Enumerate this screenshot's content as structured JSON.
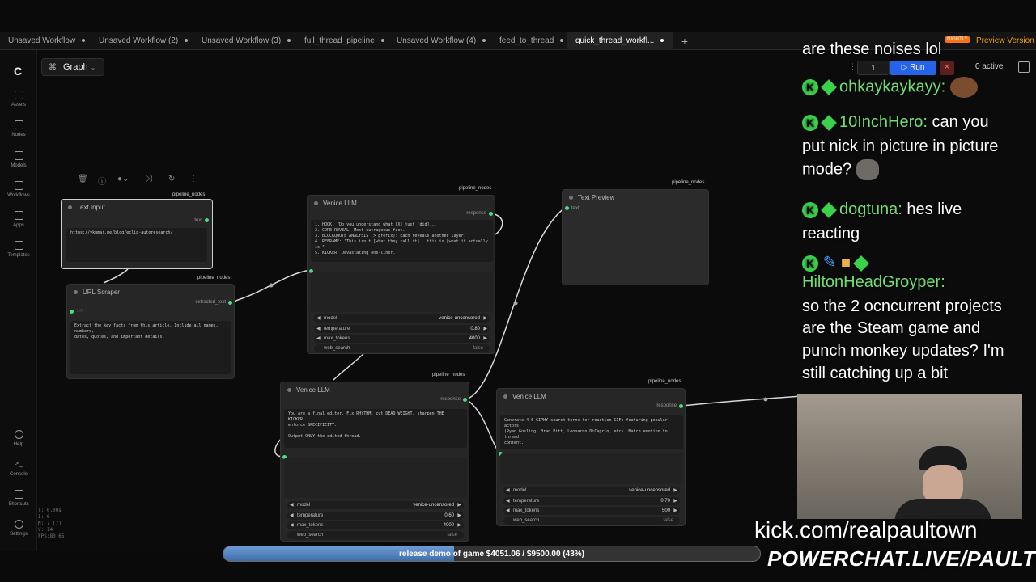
{
  "tabs": [
    {
      "label": "Unsaved Workflow"
    },
    {
      "label": "Unsaved Workflow (2)"
    },
    {
      "label": "Unsaved Workflow (3)"
    },
    {
      "label": "full_thread_pipeline"
    },
    {
      "label": "Unsaved Workflow (4)"
    },
    {
      "label": "feed_to_thread"
    },
    {
      "label": "quick_thread_workfl..."
    }
  ],
  "sidebar": {
    "items": [
      {
        "label": "Assets"
      },
      {
        "label": "Nodes"
      },
      {
        "label": "Models"
      },
      {
        "label": "Workflows"
      },
      {
        "label": "Apps"
      },
      {
        "label": "Templates"
      },
      {
        "label": "Help"
      },
      {
        "label": "Console"
      },
      {
        "label": "Shortcuts"
      },
      {
        "label": "Settings"
      }
    ]
  },
  "graph_button": "Graph",
  "run": {
    "count": "1",
    "run_label": "Run",
    "active_label": "0 active",
    "nightly": "NIGHTLY",
    "preview": "Preview Version"
  },
  "nodes": {
    "text_input": {
      "title": "Text Input",
      "tag": "pipeline_nodes",
      "port": "text",
      "value": "https://ykumar.me/blog/eclip-autoresearch/"
    },
    "url_scraper": {
      "title": "URL Scraper",
      "tag": "pipeline_nodes",
      "input": "url",
      "output": "extracted_text",
      "value": "Extract the key facts from this article. Include all names, numbers,\ndates, quotes, and important details."
    },
    "venice1": {
      "title": "Venice LLM",
      "tag": "pipeline_nodes",
      "output": "response",
      "value": "1. HOOK: \"Do you understand what [X] just [did]...\n2. CORE REVEAL: Most outrageous fact.\n3. BLOCKQUOTE ANALYSIS (> prefix): Each reveals another layer.\n4. REFRAME: \"This isn't [what they call it].. this is [what it actually\nis]\"\n5. KICKER: Devastating one-liner.\n\nSTYLE: Use .. for pauses. Short sentences. No hashtags. 150-350 words.",
      "input": "user_prompt",
      "model_label": "model",
      "model": "venice-uncensored",
      "temp_label": "temperature",
      "temp": "0.80",
      "tokens_label": "max_tokens",
      "tokens": "4000",
      "web_label": "web_search",
      "web": "false"
    },
    "text_preview": {
      "title": "Text Preview",
      "tag": "pipeline_nodes",
      "input": "text"
    },
    "venice2": {
      "title": "Venice LLM",
      "tag": "pipeline_nodes",
      "output": "response",
      "value": "You are a final editor. Fix RHYTHM, cut DEAD WEIGHT, sharpen THE KICKER,\nenforce SPECIFICITY.\n\nOutput ONLY the edited thread.",
      "input": "user_prompt",
      "model_label": "model",
      "model": "venice-uncensored",
      "temp_label": "temperature",
      "temp": "0.60",
      "tokens_label": "max_tokens",
      "tokens": "4000",
      "web_label": "web_search",
      "web": "false"
    },
    "venice3": {
      "title": "Venice LLM",
      "tag": "pipeline_nodes",
      "output": "response",
      "value": "Generate 4-6 GIPHY search terms for reaction GIFs featuring popular actors\n(Ryan Gosling, Brad Pitt, Leonardo DiCaprio, etc). Match emotion to thread\ncontent.\n\nOutput ONLY search terms, one per line.",
      "input": "user_prompt",
      "model_label": "model",
      "model": "venice-uncensored",
      "temp_label": "temperature",
      "temp": "0.70",
      "tokens_label": "max_tokens",
      "tokens": "500",
      "web_label": "web_search",
      "web": "false"
    }
  },
  "stats": {
    "t": "T: 0.00s",
    "i": "I: 0",
    "n": "N: 7 [7]",
    "v": "V: 14",
    "fps": "FPS:80.65"
  },
  "chat": {
    "line1": "are these noises lol",
    "u1": "ohkaykaykayy:",
    "u2": "10InchHero:",
    "m2a": "can you",
    "m2b": "put nick in picture in picture",
    "m2c": "mode?",
    "u3": "dogtuna:",
    "m3a": "hes live",
    "m3b": "reacting",
    "u4": "HiltonHeadGroyper:",
    "m4a": "so the 2 ocncurrent projects",
    "m4b": "are the Steam game and",
    "m4c": "punch monkey updates? I'm",
    "m4d": "still catching up a bit"
  },
  "overlay": {
    "kick": "kick.com/realpaultown",
    "powerchat": "POWERCHAT.LIVE/PAULTOWN",
    "goal_text": "release demo of game $4051.06 / $9500.00 (43%)",
    "goal_fraction": 0.43
  },
  "colors": {
    "port": "#4ade80",
    "run": "#2563eb",
    "chat_user": "#6fe06f"
  }
}
